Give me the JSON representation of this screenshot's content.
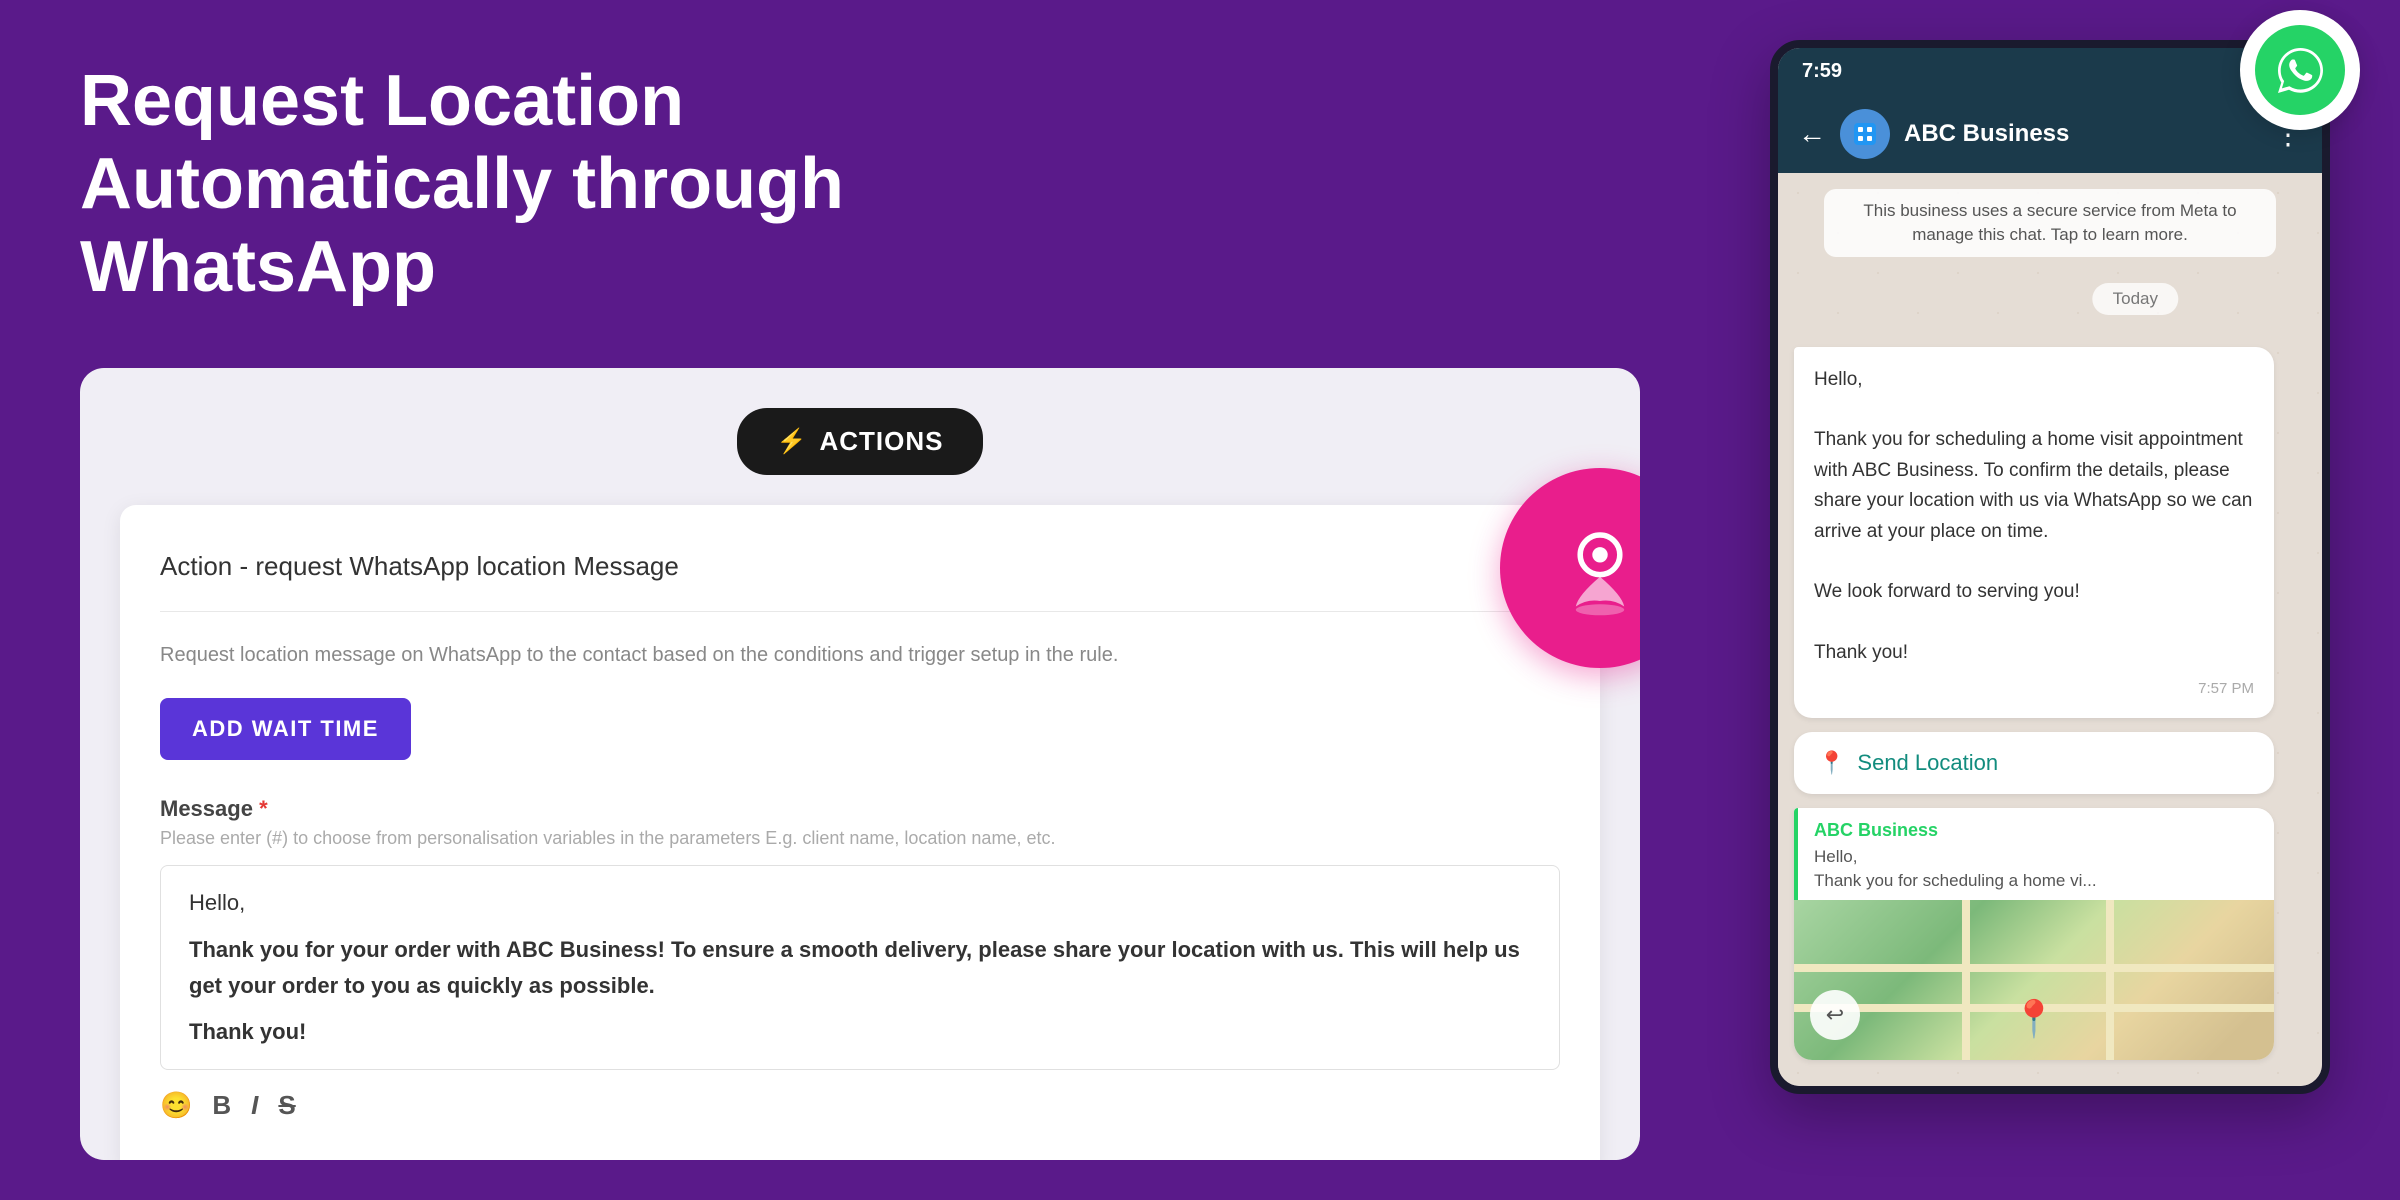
{
  "headline": {
    "line1": "Request Location Automatically through",
    "line2": "WhatsApp"
  },
  "actions_button": {
    "label": "ACTIONS",
    "icon": "⚡"
  },
  "action_card": {
    "title": "Action - request WhatsApp location Message",
    "description": "Request location message on WhatsApp to the contact based on the conditions and trigger setup in the rule.",
    "add_wait_label": "ADD WAIT TIME",
    "message_label": "Message",
    "message_hint": "Please enter (#) to choose from personalisation variables in the parameters E.g. client name, location name, etc.",
    "message_greeting": "Hello,",
    "message_body": "Thank you for your order with ABC Business! To ensure a smooth delivery, please share your location with us. This will help us get your order to you as quickly as possible.",
    "message_thanks": "Thank you!"
  },
  "toolbar": {
    "emoji": "😊",
    "bold": "B",
    "italic": "I",
    "strike": "S"
  },
  "phone": {
    "time": "7:59",
    "contact_name": "ABC Business",
    "system_message": "This business uses a secure service from Meta to manage this chat. Tap to learn more.",
    "date_label": "Today",
    "incoming_message": {
      "greeting": "Hello,",
      "body": "Thank you for scheduling a home visit appointment with ABC Business. To confirm the details, please share your location with us via WhatsApp so we can arrive at your place on time.\n\nWe look forward to serving you!\n\nThank you!",
      "time": "7:57 PM"
    },
    "send_location": "Send Location",
    "abc_card": {
      "sender": "ABC Business",
      "line1": "Hello,",
      "line2": "Thank you for scheduling a home vi..."
    }
  }
}
